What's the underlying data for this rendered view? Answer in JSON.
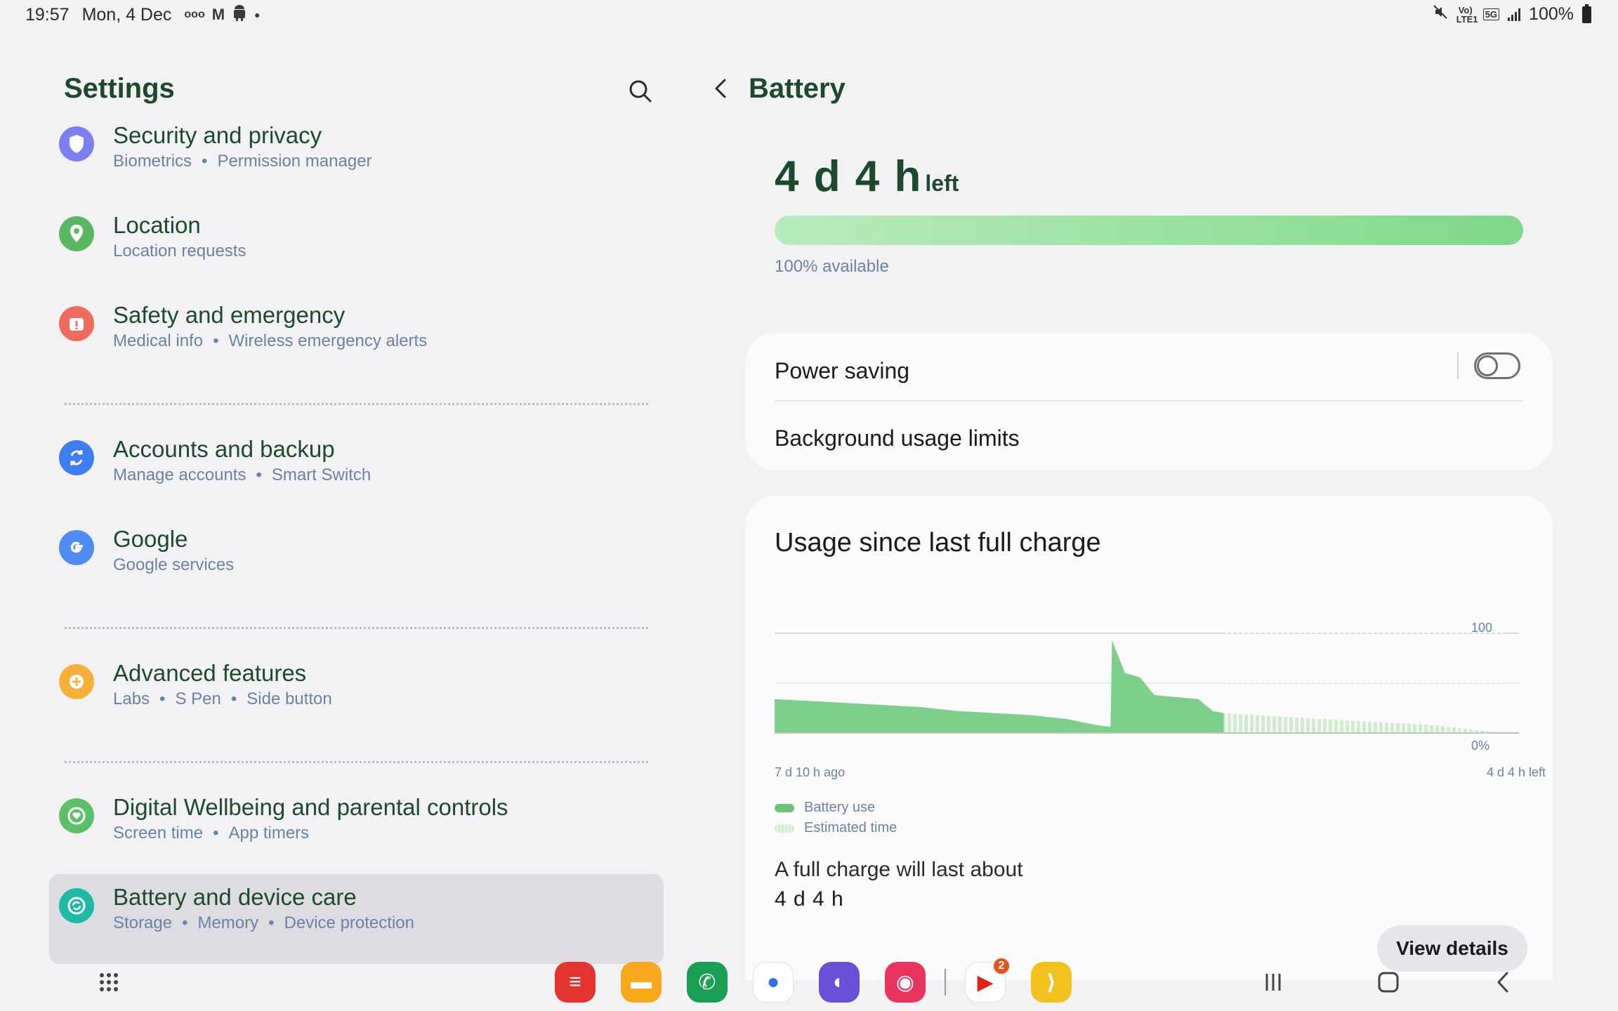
{
  "status_bar": {
    "time": "19:57",
    "date": "Mon, 4 Dec",
    "left_icons": [
      "ooo-icon",
      "gmail-icon",
      "android-icon",
      "dot-icon"
    ],
    "right_icons": [
      "mute-icon",
      "volte-icon",
      "5g-icon",
      "signal-icon"
    ],
    "volte_label": "Vo) LTE1",
    "net_label": "5G",
    "battery_percent": "100%"
  },
  "settings": {
    "title": "Settings",
    "items": [
      {
        "title": "Security and privacy",
        "subs": [
          "Biometrics",
          "Permission manager"
        ],
        "icon": "shield-icon",
        "color": "#7b7ff0"
      },
      {
        "title": "Location",
        "subs": [
          "Location requests"
        ],
        "icon": "location-pin-icon",
        "color": "#5cb860"
      },
      {
        "title": "Safety and emergency",
        "subs": [
          "Medical info",
          "Wireless emergency alerts"
        ],
        "icon": "alert-icon",
        "color": "#ef6b5d"
      },
      {
        "title": "Accounts and backup",
        "subs": [
          "Manage accounts",
          "Smart Switch"
        ],
        "icon": "sync-icon",
        "color": "#3f7ef0"
      },
      {
        "title": "Google",
        "subs": [
          "Google services"
        ],
        "icon": "google-icon",
        "color": "#4f8df5"
      },
      {
        "title": "Advanced features",
        "subs": [
          "Labs",
          "S Pen",
          "Side button"
        ],
        "icon": "gear-plus-icon",
        "color": "#f6b13b"
      },
      {
        "title": "Digital Wellbeing and parental controls",
        "subs": [
          "Screen time",
          "App timers"
        ],
        "icon": "heart-circle-icon",
        "color": "#5cbf6a"
      },
      {
        "title": "Battery and device care",
        "subs": [
          "Storage",
          "Memory",
          "Device protection"
        ],
        "icon": "device-care-icon",
        "color": "#1fbaa5"
      }
    ]
  },
  "battery": {
    "title": "Battery",
    "time_left": "4 d 4 h",
    "time_left_suffix": "left",
    "level_percent": 100,
    "available_text": "100% available",
    "power_saving_label": "Power saving",
    "power_saving_on": false,
    "background_limits_label": "Background usage limits",
    "usage_title": "Usage since last full charge",
    "chart_data": {
      "type": "area",
      "y_ticks": [
        "100",
        "0%"
      ],
      "ylim": [
        0,
        100
      ],
      "x_start_label": "7 d 10 h ago",
      "x_end_label": "4 d 4 h left",
      "series": [
        {
          "name": "Battery use",
          "color": "#7fcf8c",
          "points": [
            [
              0,
              34
            ],
            [
              5,
              32
            ],
            [
              10,
              30
            ],
            [
              15,
              28
            ],
            [
              20,
              26
            ],
            [
              25,
              22
            ],
            [
              30,
              20
            ],
            [
              35,
              18
            ],
            [
              40,
              14
            ],
            [
              44,
              8
            ],
            [
              46,
              6
            ],
            [
              46.2,
              93
            ],
            [
              47,
              78
            ],
            [
              48,
              60
            ],
            [
              50,
              56
            ],
            [
              52,
              38
            ],
            [
              55,
              36
            ],
            [
              58,
              34
            ],
            [
              60,
              22
            ],
            [
              61.5,
              20
            ]
          ]
        },
        {
          "name": "Estimated time",
          "color": "#cfeccf",
          "points": [
            [
              61.5,
              20
            ],
            [
              70,
              16
            ],
            [
              80,
              12
            ],
            [
              90,
              8
            ],
            [
              96,
              3
            ],
            [
              100,
              0
            ]
          ]
        }
      ]
    },
    "legend": [
      {
        "label": "Battery use",
        "color": "#6cc47b"
      },
      {
        "label": "Estimated time",
        "color": "#cfeccf"
      }
    ],
    "full_charge_label": "A full charge will last about",
    "full_charge_value": "4 d 4 h",
    "view_details_label": "View details"
  },
  "dock": {
    "apps": [
      {
        "name": "notes-app-icon",
        "color": "#e3342f",
        "glyph": "≡"
      },
      {
        "name": "files-app-icon",
        "color": "#f7a81b",
        "glyph": "▬"
      },
      {
        "name": "phone-app-icon",
        "color": "#1a9e54",
        "glyph": "✆"
      },
      {
        "name": "messages-app-icon",
        "color": "#ffffff",
        "glyph": "●"
      },
      {
        "name": "internet-app-icon",
        "color": "#6a4fd6",
        "glyph": "◐"
      },
      {
        "name": "camera-app-icon",
        "color": "#e8335f",
        "glyph": "◉"
      },
      {
        "name": "youtube-app-icon",
        "color": "#ffffff",
        "glyph": "▶",
        "badge": "2"
      },
      {
        "name": "plex-app-icon",
        "color": "#f4c21f",
        "glyph": "⟩"
      }
    ]
  }
}
